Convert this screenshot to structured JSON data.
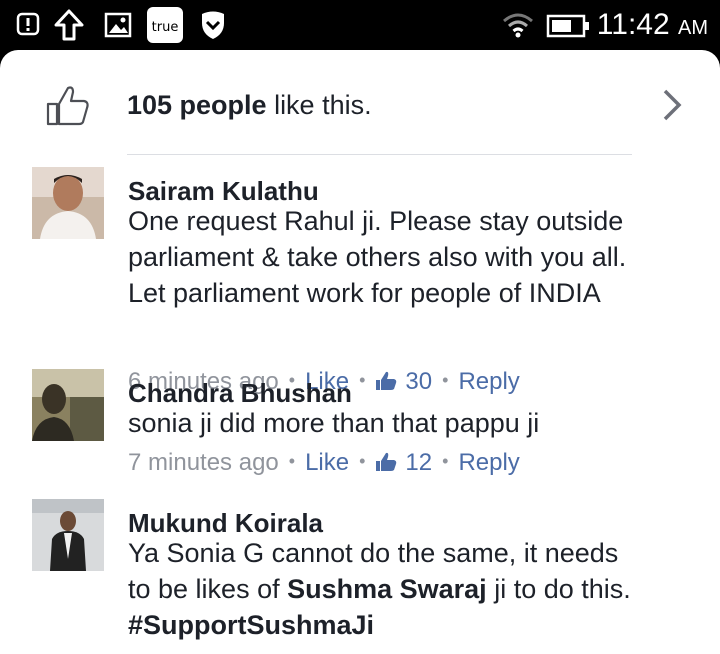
{
  "status_bar": {
    "time": "11:42",
    "ampm": "AM",
    "carrier_badge": "true",
    "icons": [
      "alert-icon",
      "upload-icon",
      "image-icon",
      "truecaller-icon",
      "shield-icon",
      "wifi-icon",
      "battery-icon"
    ]
  },
  "likes": {
    "count_label": "105 people",
    "suffix": " like this."
  },
  "comments": [
    {
      "author": "Sairam Kulathu",
      "lines": [
        "One request Rahul ji. Please stay outside",
        "parliament & take others also with you all.",
        "Let parliament work for people of INDIA"
      ],
      "time": "6 minutes ago",
      "like_label": "Like",
      "like_count": "30",
      "reply_label": "Reply"
    },
    {
      "author": "Chandra Bhushan",
      "lines": [
        "sonia ji  did more than that pappu ji"
      ],
      "time": "7 minutes ago",
      "like_label": "Like",
      "like_count": "12",
      "reply_label": "Reply"
    },
    {
      "author": "Mukund Koirala",
      "line1": "Ya Sonia G cannot do the same, it needs",
      "line2_pre": "to be likes of ",
      "line2_bold": "Sushma Swaraj",
      "line2_post": " ji to do this.",
      "line3": "#SupportSushmaJi"
    }
  ],
  "colors": {
    "link": "#4b6ca7",
    "meta": "#90949c",
    "text": "#1d2129"
  }
}
